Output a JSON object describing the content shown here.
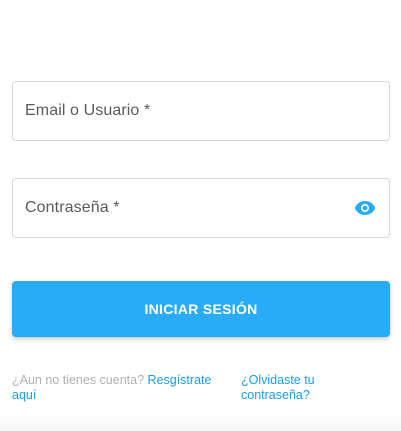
{
  "form": {
    "user_label": "Email o Usuario *",
    "password_label": "Contraseña *",
    "show_password_icon": "eye-icon",
    "submit_label": "INICIAR SESIÓN",
    "accent_color": "#29abf7"
  },
  "links": {
    "no_account_text": "¿Aun no tienes cuenta?",
    "register_link": "Resgístrate aquí",
    "forgot_password_link": "¿Olvidaste tu contraseña?"
  }
}
